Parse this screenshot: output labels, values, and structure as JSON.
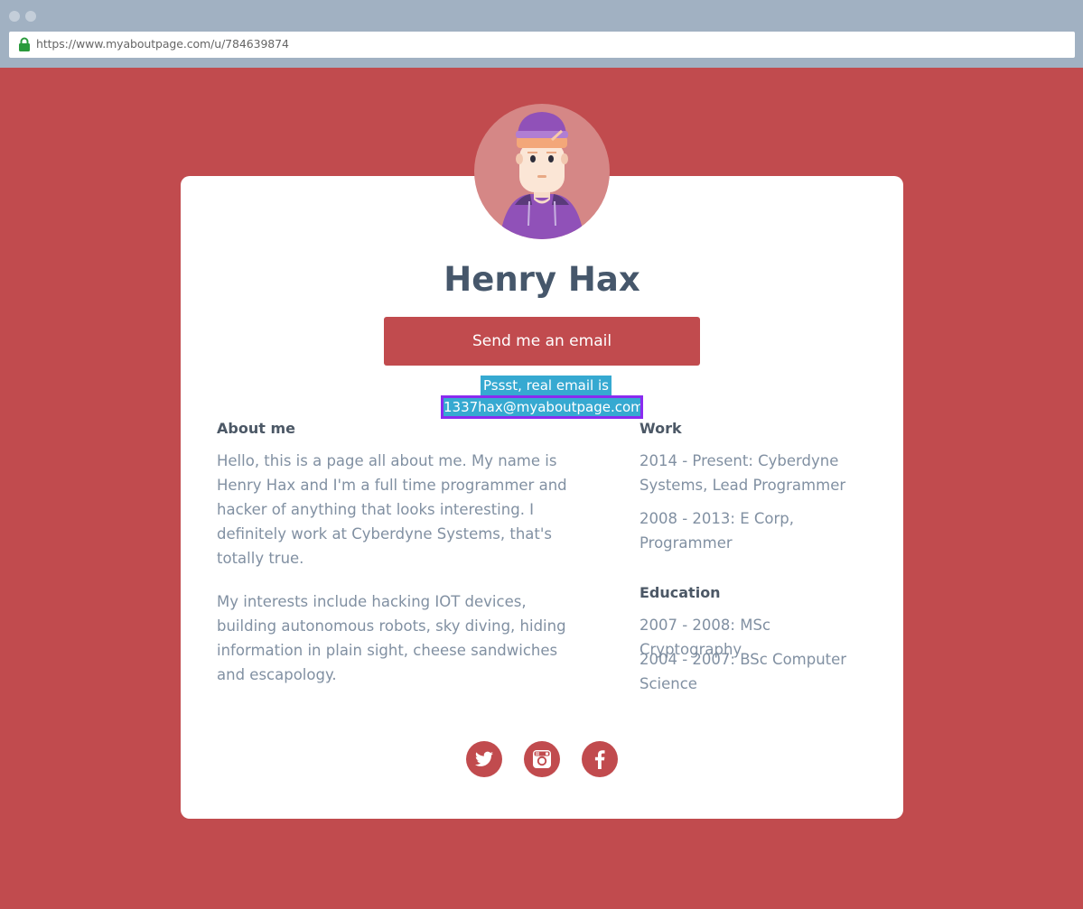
{
  "browser": {
    "url": "https://www.myaboutpage.com/u/784639874"
  },
  "profile": {
    "name": "Henry Hax",
    "email_button_label": "Send me an email",
    "secret_line1": "Pssst, real email is",
    "secret_email": "1337hax@myaboutpage.com"
  },
  "about": {
    "heading": "About me",
    "paragraphs": [
      "Hello, this is a page all about me. My name is Henry Hax and I'm a full time programmer and hacker of anything that looks interesting. I definitely work at Cyberdyne Systems, that's totally true.",
      "My interests include hacking IOT devices, building autonomous robots, sky diving, hiding information in plain sight, cheese sandwiches and escapology."
    ]
  },
  "work": {
    "heading": "Work",
    "items": [
      "2014 - Present: Cyberdyne Systems, Lead Programmer",
      "2008 - 2013: E Corp, Programmer"
    ]
  },
  "education": {
    "heading": "Education",
    "items": [
      "2007 - 2008: MSc Cryptography",
      "2004 - 2007: BSc Computer Science"
    ]
  },
  "social": {
    "icons": [
      "twitter-icon",
      "instagram-icon",
      "facebook-icon"
    ]
  },
  "colors": {
    "page_background": "#c14b4e",
    "accent": "#c14b4e",
    "highlight": "#36a9d1",
    "highlight_border": "#8a2bf0"
  }
}
